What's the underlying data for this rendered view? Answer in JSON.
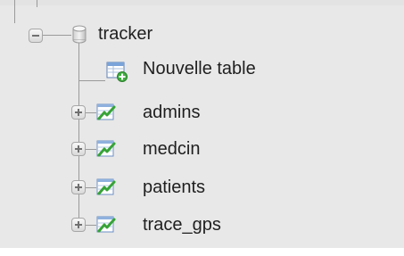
{
  "tree": {
    "database": {
      "name": "tracker",
      "icon": "database-icon",
      "expanded": true
    },
    "new_table": {
      "label": "Nouvelle table",
      "icon": "new-table-icon"
    },
    "tables": [
      {
        "name": "admins",
        "icon": "table-icon",
        "expanded": false
      },
      {
        "name": "medcin",
        "icon": "table-icon",
        "expanded": false
      },
      {
        "name": "patients",
        "icon": "table-icon",
        "expanded": false
      },
      {
        "name": "trace_gps",
        "icon": "table-icon",
        "expanded": false
      }
    ]
  },
  "colors": {
    "panel_bg": "#e8e8e8",
    "text": "#1f1f1f",
    "connector": "#9a9a9a",
    "table_icon_green": "#3aa83a",
    "table_icon_blue": "#4a86c8"
  }
}
